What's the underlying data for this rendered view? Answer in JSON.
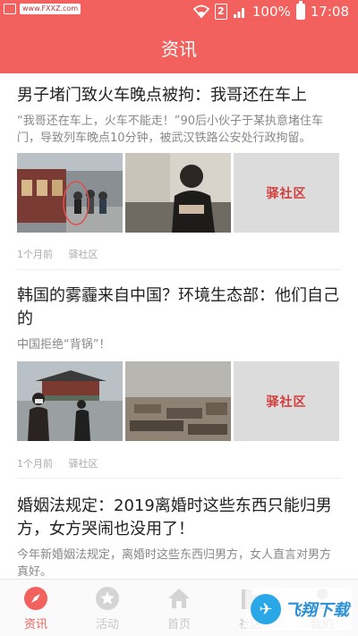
{
  "status_bar": {
    "watermark": "www.FXXZ.com",
    "battery": "100%",
    "time": "17:08",
    "sim": "2"
  },
  "header": {
    "title": "资讯"
  },
  "articles": [
    {
      "title": "男子堵门致火车晚点被拘：我哥还在车上",
      "summary": "“我哥还在车上，火车不能走！”90后小伙子于某执意堵住车门，导致列车晚点10分钟，被武汉铁路公安处行政拘留。",
      "time": "1个月前",
      "source": "驿社区",
      "logo_text": "驿社区"
    },
    {
      "title": "韩国的雾霾来自中国？环境生态部：他们自己的",
      "summary": "中国拒绝“背锅”！",
      "time": "1个月前",
      "source": "驿社区",
      "logo_text": "驿社区"
    },
    {
      "title": "婚姻法规定：2019离婚时这些东西只能归男方，女方哭闹也没用了！",
      "summary": "今年新婚姻法规定，离婚时这些东西归男方，女人直言对男方真好。"
    }
  ],
  "tabs": [
    {
      "label": "资讯",
      "icon": "compass-icon",
      "active": true
    },
    {
      "label": "活动",
      "icon": "star-icon",
      "active": false
    },
    {
      "label": "首页",
      "icon": "home-icon",
      "active": false
    },
    {
      "label": "社区",
      "icon": "building-icon",
      "active": false
    },
    {
      "label": "我的",
      "icon": "user-icon",
      "active": false
    }
  ],
  "brand_badge": {
    "text": "飞翔下载"
  },
  "colors": {
    "accent": "#f2615e",
    "muted": "#c8c8c8"
  }
}
